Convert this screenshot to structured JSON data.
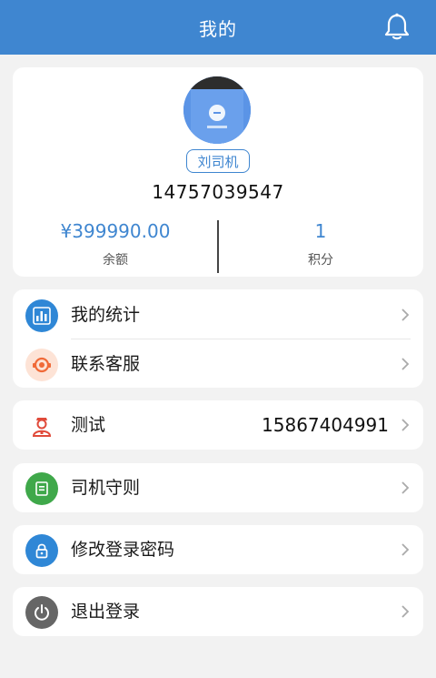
{
  "header": {
    "title": "我的"
  },
  "profile": {
    "name": "刘司机",
    "phone": "14757039547",
    "balance_value": "¥399990.00",
    "balance_label": "余额",
    "points_value": "1",
    "points_label": "积分"
  },
  "menu": {
    "stats": {
      "label": "我的统计",
      "icon": "bar-chart-icon",
      "color": "#2f87d6"
    },
    "service": {
      "label": "联系客服",
      "icon": "headset-icon",
      "color": "#f06a38"
    },
    "test": {
      "label": "测试",
      "value": "15867404991",
      "icon": "driver-icon",
      "color": "#e04a3a"
    },
    "rules": {
      "label": "司机守则",
      "icon": "document-icon",
      "color": "#3fa84a"
    },
    "password": {
      "label": "修改登录密码",
      "icon": "lock-icon",
      "color": "#2f87d6"
    },
    "logout": {
      "label": "退出登录",
      "icon": "power-icon",
      "color": "#666666"
    }
  },
  "colors": {
    "accent": "#3f86d0",
    "background": "#f2f2f2"
  }
}
